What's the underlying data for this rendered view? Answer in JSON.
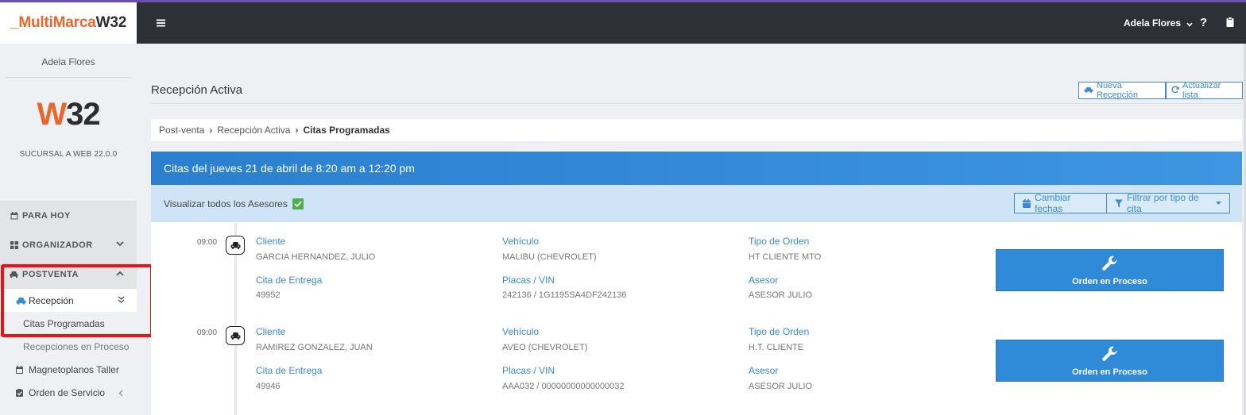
{
  "sidebar": {
    "logo_prefix": "_MultiMarca",
    "logo_suffix": "W32",
    "user_name": "Adela Flores",
    "brand_w": "W",
    "brand_rest": "32",
    "branch": "SUCURSAL A WEB 22.0.0",
    "menu": {
      "para_hoy": "PARA HOY",
      "organizador": "ORGANIZADOR",
      "postventa": "POSTVENTA",
      "recepcion": "Recepción",
      "citas_programadas": "Citas Programadas",
      "recepciones_proceso": "Recepciones en Proceso",
      "magnetoplanos": "Magnetoplanos Taller",
      "orden_servicio": "Orden de Servicio"
    }
  },
  "navbar": {
    "user": "Adela Flores",
    "help": "?"
  },
  "main": {
    "title": "Recepción Activa",
    "btn_nueva": "Nueva Recepción",
    "btn_actualizar": "Actualizar lista",
    "breadcrumb": [
      "Post-venta",
      "Recepción Activa",
      "Citas Programadas"
    ],
    "panel_title": "Citas del jueves 21 de abril de 8:20 am a 12:20 pm",
    "filter_label": "Visualizar todos los Asesores",
    "btn_fechas": "Cambiar fechas",
    "btn_filtrar": "Filtrar por tipo de cita"
  },
  "labels": {
    "cliente": "Cliente",
    "vehiculo": "Vehículo",
    "tipo_orden": "Tipo de Orden",
    "cita_entrega": "Cita de Entrega",
    "placas": "Placas / VIN",
    "asesor": "Asesor",
    "order_btn": "Orden en Proceso"
  },
  "appointments": [
    {
      "time": "09:00",
      "cliente": "GARCIA HERNANDEZ, JULIO",
      "vehiculo": "MALIBU (CHEVROLET)",
      "tipo_orden": "HT CLIENTE MTO",
      "cita_entrega": "49952",
      "placas": "242136 / 1G1195SA4DF242136",
      "asesor": "ASESOR JULIO"
    },
    {
      "time": "09:00",
      "cliente": "RAMIREZ GONZALEZ, JUAN",
      "vehiculo": "AVEO (CHEVROLET)",
      "tipo_orden": "H.T. CLIENTE",
      "cita_entrega": "49946",
      "placas": "AAA032 / 00000000000000032",
      "asesor": "ASESOR JULIO"
    }
  ],
  "colors": {
    "accent": "#3b8bd4",
    "brand_orange": "#e8672a",
    "navbar": "#2d3035",
    "highlight": "#e11111"
  }
}
